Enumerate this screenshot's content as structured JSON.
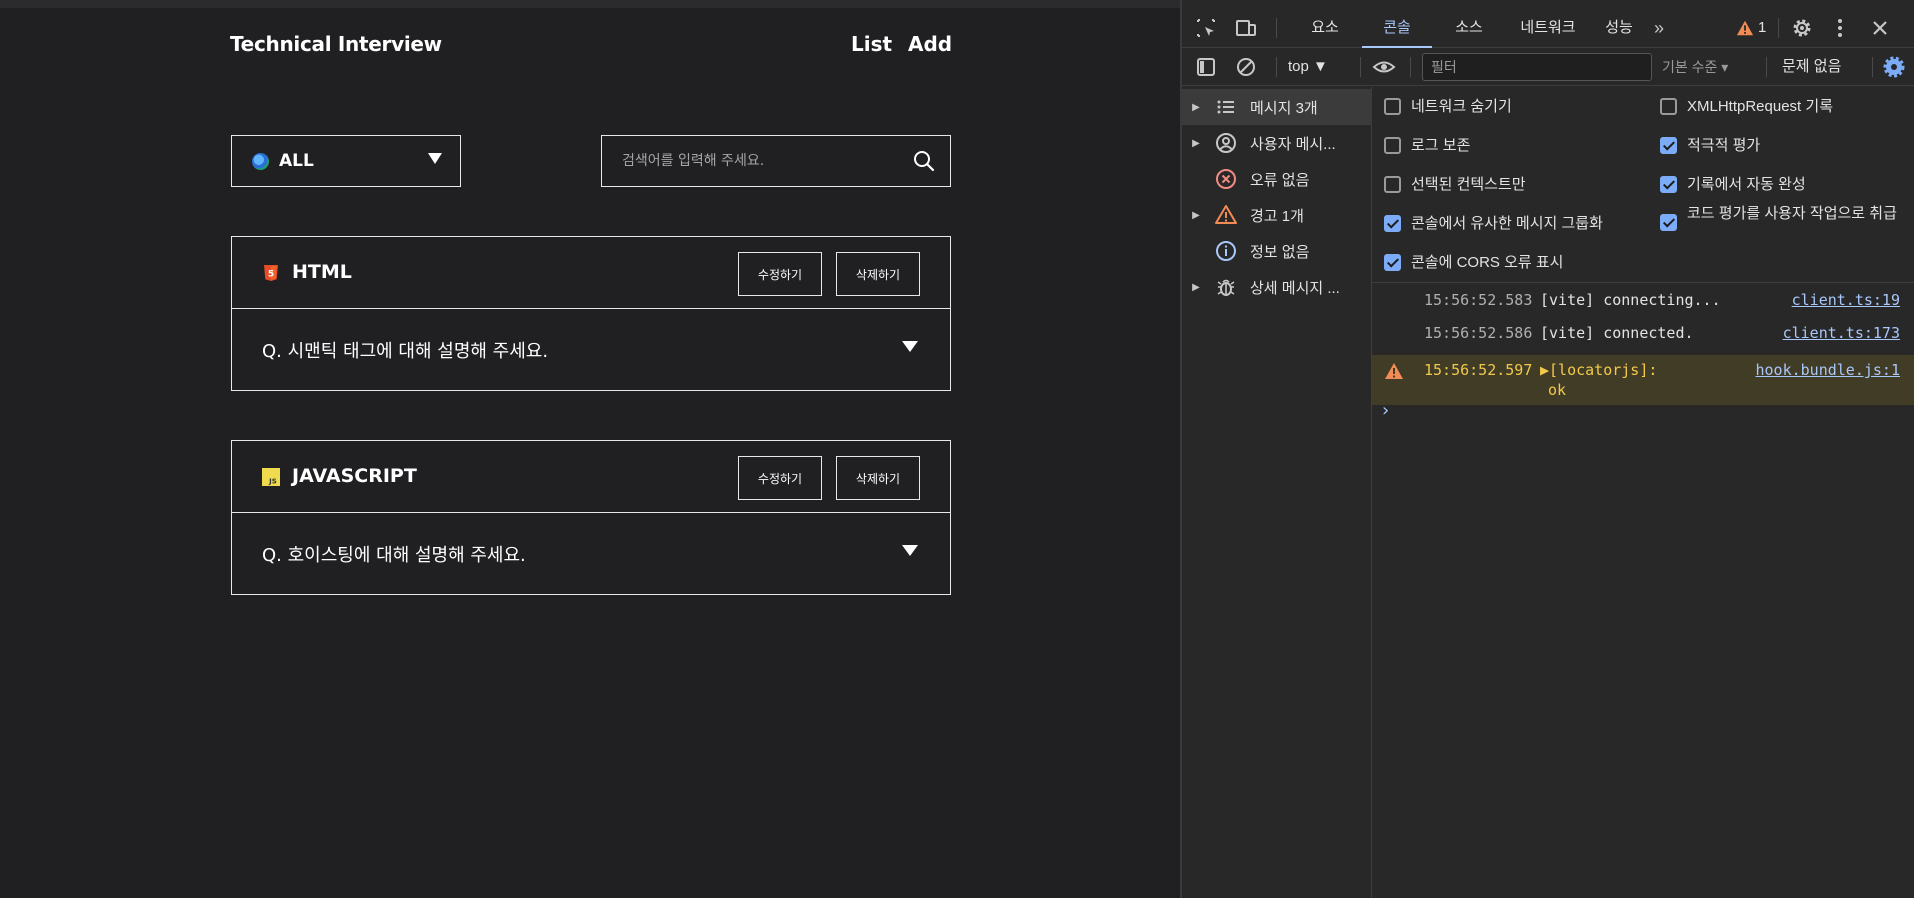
{
  "app": {
    "brand": "Technical Interview",
    "nav": {
      "list": "List",
      "add": "Add"
    },
    "filter": {
      "selected": "ALL",
      "icon": "globe-icon"
    },
    "search": {
      "placeholder": "검색어를 입력해 주세요.",
      "value": ""
    },
    "cards": [
      {
        "category": "HTML",
        "logo": "html5-icon",
        "edit_label": "수정하기",
        "delete_label": "삭제하기",
        "question": "Q. 시맨틱 태그에 대해 설명해 주세요."
      },
      {
        "category": "JAVASCRIPT",
        "logo": "javascript-icon",
        "edit_label": "수정하기",
        "delete_label": "삭제하기",
        "question": "Q. 호이스팅에 대해 설명해 주세요."
      }
    ]
  },
  "devtools": {
    "tabs": [
      "요소",
      "콘솔",
      "소스",
      "네트워크",
      "성능",
      "»"
    ],
    "active_tab": "콘솔",
    "warning_count": "1",
    "toolbar": {
      "context": "top ▼",
      "filter_placeholder": "필터",
      "levels": "기본 수준 ▾",
      "issues": "문제 없음"
    },
    "sidebar": [
      {
        "label": "메시지 3개",
        "icon": "list-icon",
        "expandable": true
      },
      {
        "label": "사용자 메시...",
        "icon": "user-icon",
        "expandable": true
      },
      {
        "label": "오류 없음",
        "icon": "error-icon",
        "expandable": false
      },
      {
        "label": "경고 1개",
        "icon": "warning-icon",
        "expandable": true
      },
      {
        "label": "정보 없음",
        "icon": "info-icon",
        "expandable": false
      },
      {
        "label": "상세 메시지 ...",
        "icon": "bug-icon",
        "expandable": true
      }
    ],
    "settings": {
      "left": [
        {
          "label": "네트워크 숨기기",
          "checked": false
        },
        {
          "label": "로그 보존",
          "checked": false
        },
        {
          "label": "선택된 컨텍스트만",
          "checked": false
        },
        {
          "label": "콘솔에서 유사한 메시지 그룹화",
          "checked": true
        },
        {
          "label": "콘솔에 CORS 오류 표시",
          "checked": true
        }
      ],
      "right": [
        {
          "label": "XMLHttpRequest 기록",
          "checked": false
        },
        {
          "label": "적극적 평가",
          "checked": true
        },
        {
          "label": "기록에서 자동 완성",
          "checked": true
        },
        {
          "label": "코드 평가를 사용자 작업으로 취급",
          "checked": true
        }
      ]
    },
    "logs": [
      {
        "time": "15:56:52.583",
        "message": "[vite] connecting...",
        "source": "client.ts:19",
        "level": "info"
      },
      {
        "time": "15:56:52.586",
        "message": "[vite] connected.",
        "source": "client.ts:173",
        "level": "info"
      },
      {
        "time": "15:56:52.597",
        "message": "▶[locatorjs]:",
        "message2": "ok",
        "source": "hook.bundle.js:1",
        "level": "warning"
      }
    ],
    "prompt": "›",
    "colors": {
      "accent": "#a8c7fa",
      "warning": "#f2c94c",
      "error": "#f28b82",
      "checkbox": "#7cacf8"
    }
  }
}
